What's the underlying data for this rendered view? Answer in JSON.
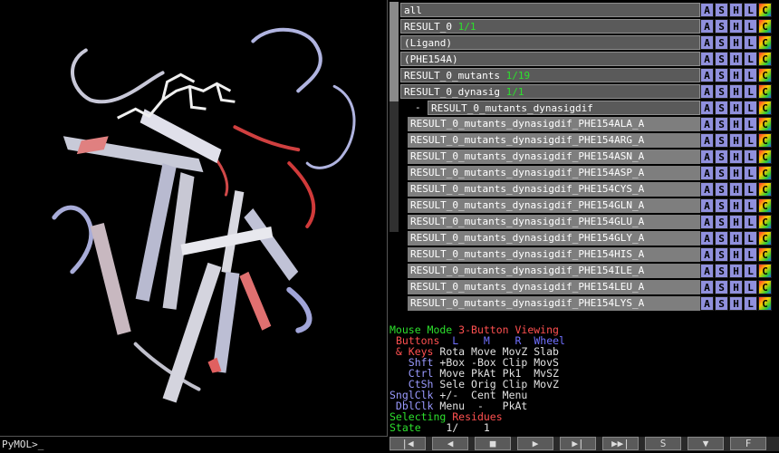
{
  "command": {
    "prompt": "PyMOL>_"
  },
  "object_buttons": [
    "A",
    "S",
    "H",
    "L",
    "C"
  ],
  "objects": [
    {
      "name": "all",
      "count": ""
    },
    {
      "name": "RESULT_0",
      "count": "1/1"
    },
    {
      "name": "(Ligand)",
      "count": ""
    },
    {
      "name": "(PHE154A)",
      "count": ""
    },
    {
      "name": "RESULT_0_mutants",
      "count": "1/19"
    },
    {
      "name": "RESULT_0_dynasig",
      "count": "1/1"
    },
    {
      "name": "RESULT_0_mutants_dynasigdif",
      "count": "",
      "prefix": "-"
    }
  ],
  "sub_objects": [
    "RESULT_0_mutants_dynasigdif_PHE154ALA_A",
    "RESULT_0_mutants_dynasigdif_PHE154ARG_A",
    "RESULT_0_mutants_dynasigdif_PHE154ASN_A",
    "RESULT_0_mutants_dynasigdif_PHE154ASP_A",
    "RESULT_0_mutants_dynasigdif_PHE154CYS_A",
    "RESULT_0_mutants_dynasigdif_PHE154GLN_A",
    "RESULT_0_mutants_dynasigdif_PHE154GLU_A",
    "RESULT_0_mutants_dynasigdif_PHE154GLY_A",
    "RESULT_0_mutants_dynasigdif_PHE154HIS_A",
    "RESULT_0_mutants_dynasigdif_PHE154ILE_A",
    "RESULT_0_mutants_dynasigdif_PHE154LEU_A",
    "RESULT_0_mutants_dynasigdif_PHE154LYS_A"
  ],
  "mouse_mode": {
    "title_a": "Mouse Mode ",
    "title_b": "3-Button Viewing",
    "header": {
      "buttons": "Buttons",
      "l": "L",
      "m": "M",
      "r": "R",
      "wheel": "Wheel"
    },
    "rows": [
      {
        "k": " & Keys",
        "v": "Rota Move MovZ Slab"
      },
      {
        "k": "   Shft",
        "v": "+Box -Box Clip MovS"
      },
      {
        "k": "   Ctrl",
        "v": "Move PkAt Pk1  MvSZ"
      },
      {
        "k": "   CtSh",
        "v": "Sele Orig Clip MovZ"
      },
      {
        "k": "SnglClk",
        "v": "+/-  Cent Menu"
      },
      {
        "k": " DblClk",
        "v": "Menu  -   PkAt"
      }
    ],
    "selecting_a": "Selecting ",
    "selecting_b": "Residues",
    "state_label": "State",
    "state_value": "    1/    1"
  },
  "playback": [
    "|◀",
    "◀",
    "■",
    "▶",
    "▶|",
    "▶▶|",
    "S",
    "▼",
    "F"
  ]
}
